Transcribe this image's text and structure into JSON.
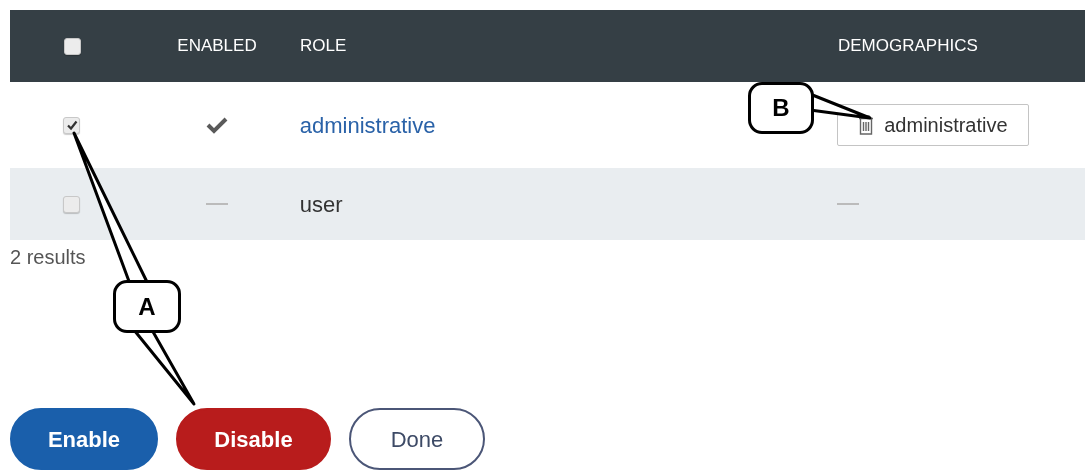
{
  "table": {
    "select_all": {
      "checked": false
    },
    "columns": [
      "ENABLED",
      "ROLE",
      "DEMOGRAPHICS"
    ],
    "rows": [
      {
        "checked": true,
        "enabled": true,
        "role": "administrative",
        "role_is_link": true,
        "demographics": [
          "administrative"
        ]
      },
      {
        "checked": false,
        "enabled": false,
        "role": "user",
        "role_is_link": false,
        "demographics": []
      }
    ]
  },
  "result_count": "2 results",
  "buttons": [
    {
      "label": "Enable",
      "kind": "primary"
    },
    {
      "label": "Disable",
      "kind": "danger"
    },
    {
      "label": "Done",
      "kind": "outline"
    }
  ],
  "callouts": [
    {
      "label": "A"
    },
    {
      "label": "B"
    }
  ]
}
